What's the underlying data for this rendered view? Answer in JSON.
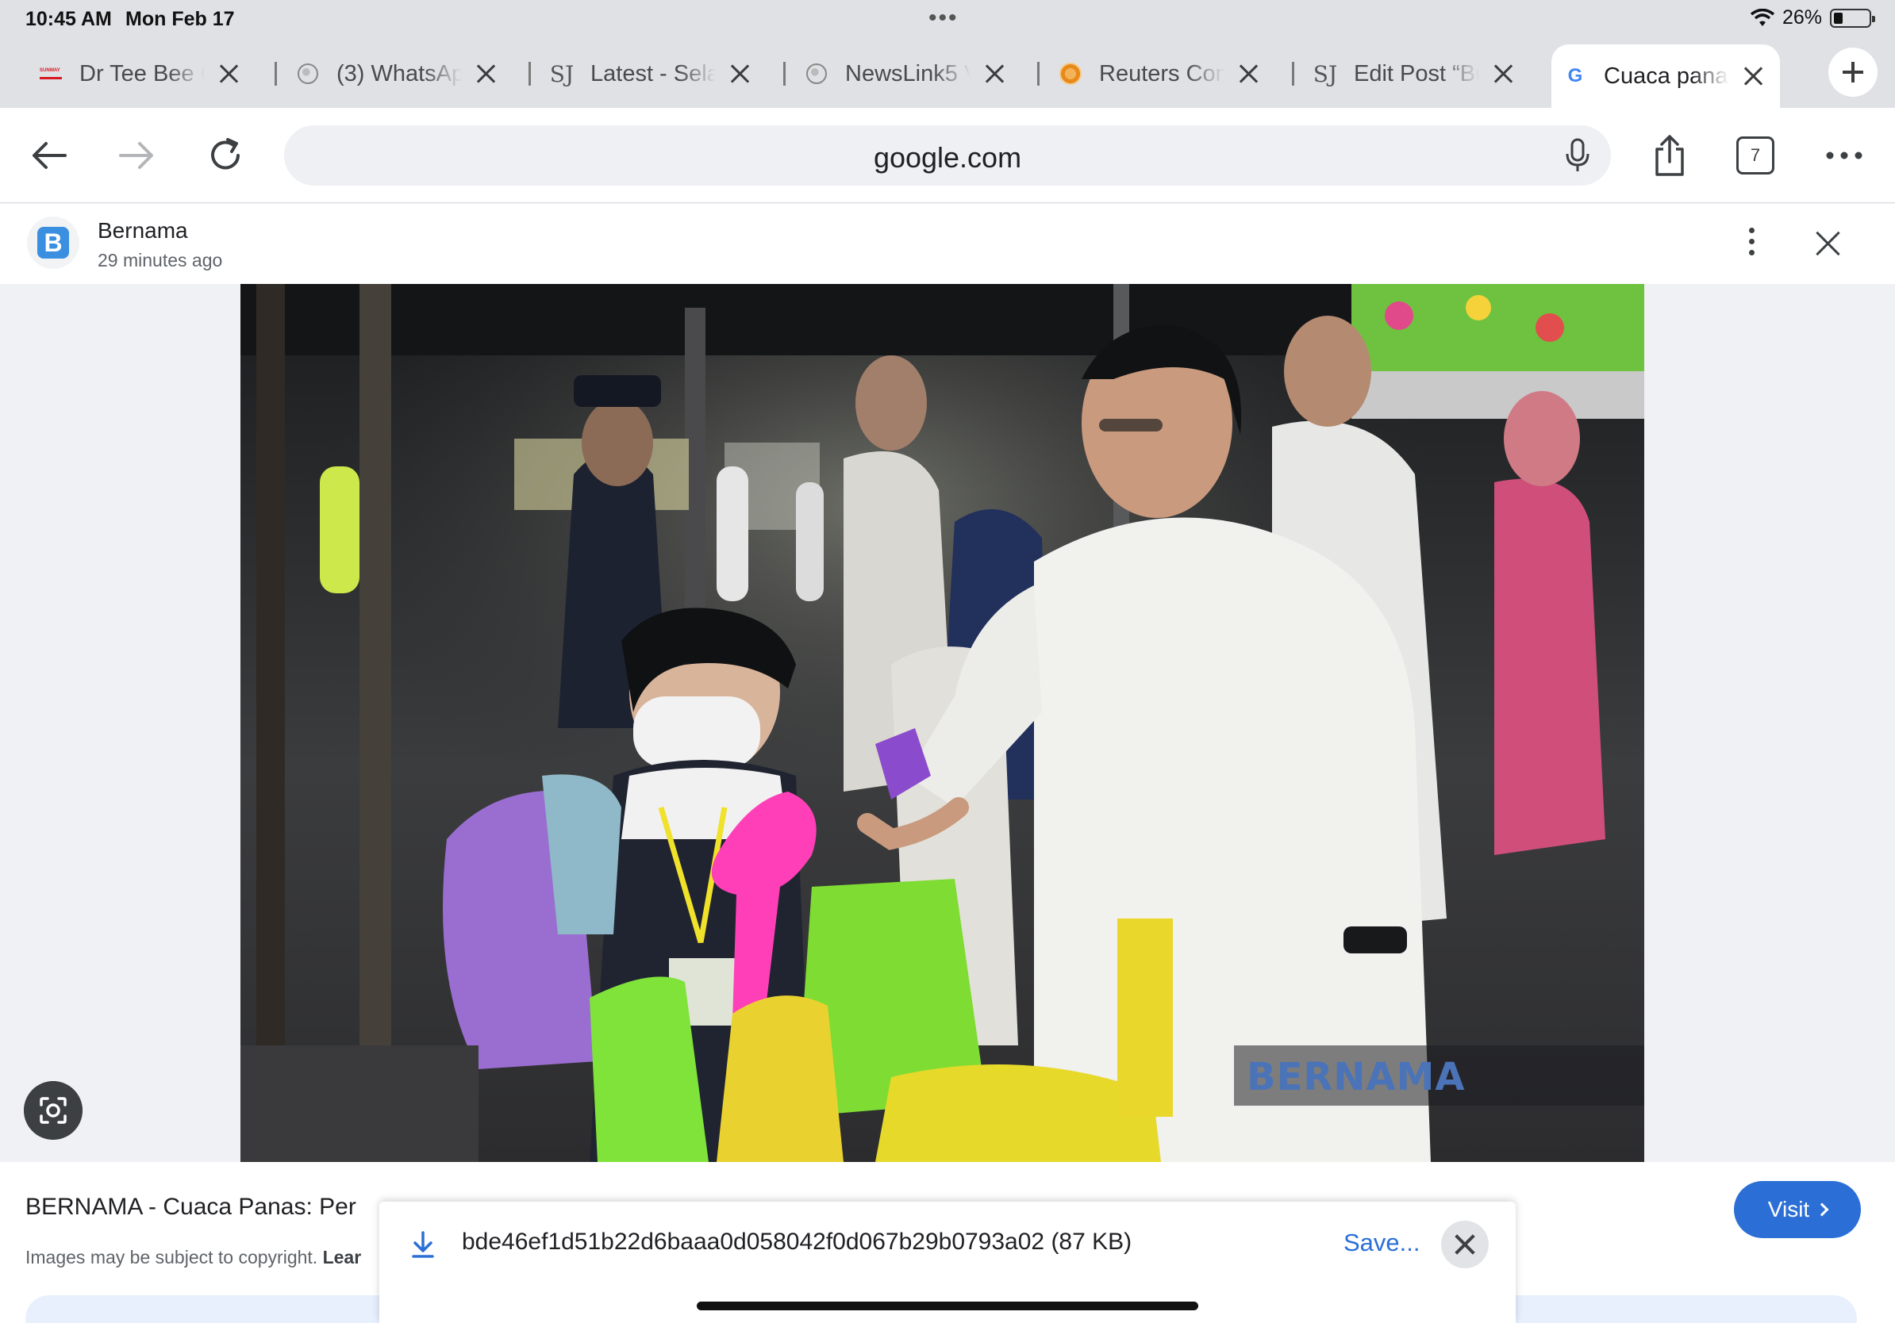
{
  "status_bar": {
    "time": "10:45 AM",
    "date": "Mon Feb 17",
    "battery": "26%",
    "battery_level": 0.26
  },
  "tabs": [
    {
      "label": "Dr Tee Bee C",
      "icon": "sunway-favicon"
    },
    {
      "label": "(3) WhatsAp",
      "icon": "globe-icon"
    },
    {
      "label": "Latest - Sela",
      "icon": "sj-favicon"
    },
    {
      "label": "NewsLink5 V",
      "icon": "globe-icon"
    },
    {
      "label": "Reuters Con",
      "icon": "reuters-favicon"
    },
    {
      "label": "Edit Post “Bu",
      "icon": "sj-favicon"
    },
    {
      "label": "Cuaca panas",
      "icon": "google-g-icon",
      "active": true
    }
  ],
  "toolbar": {
    "url": "google.com",
    "tab_count": "7"
  },
  "viewer": {
    "source_name": "Bernama",
    "source_time": "29 minutes ago",
    "watermark": "BERNAMA",
    "result_title": "BERNAMA - Cuaca Panas: Per",
    "copyright_text": "Images may be subject to copyright. ",
    "copyright_link": "Lear",
    "visit_label": "Visit"
  },
  "download": {
    "filename": "bde46ef1d51b22d6baaa0d058042f0d067b29b0793a02 (87 KB)",
    "save_label": "Save..."
  },
  "colors": {
    "accent": "#2b6fd6",
    "tab_strip": "#dfe1e5"
  }
}
